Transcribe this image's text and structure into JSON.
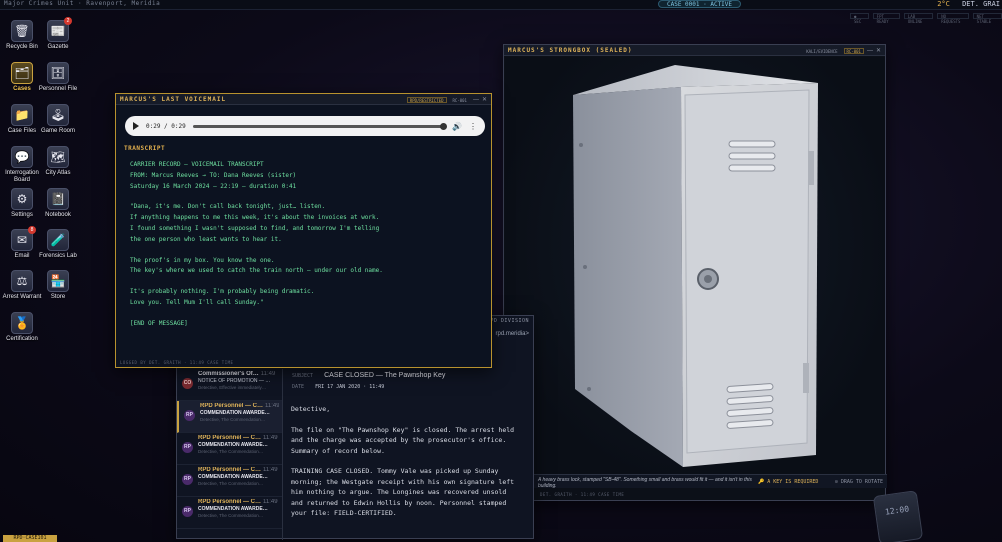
{
  "topbar": {
    "subtitle": "Major Crimes Unit · Ravenport, Meridia",
    "case_status": "CASE 0001 · ACTIVE",
    "temperature": "2°C",
    "detective": "DET. GRAI"
  },
  "status_strip": [
    "● SEC",
    "FPT READY",
    "LAB ONLINE",
    "NO REQUESTS",
    "NET STABLE"
  ],
  "desktop": {
    "icons": [
      {
        "label": "Recycle Bin",
        "glyph": "🗑",
        "icon": "trash-icon"
      },
      {
        "label": "Gazette",
        "glyph": "📰",
        "icon": "newspaper-icon",
        "badge": "2"
      },
      {
        "label": "Cases",
        "glyph": "🗂",
        "icon": "folder-icon",
        "active": true
      },
      {
        "label": "Personnel File",
        "glyph": "🗄",
        "icon": "cabinet-icon"
      },
      {
        "label": "Case Files",
        "glyph": "📁",
        "icon": "folder-icon"
      },
      {
        "label": "Game Room",
        "glyph": "🕹",
        "icon": "joystick-icon"
      },
      {
        "label": "Interrogation Board",
        "glyph": "💬",
        "icon": "speech-icon"
      },
      {
        "label": "City Atlas",
        "glyph": "🗺",
        "icon": "map-icon"
      },
      {
        "label": "Settings",
        "glyph": "⚙",
        "icon": "gear-icon"
      },
      {
        "label": "Notebook",
        "glyph": "📓",
        "icon": "notebook-icon"
      },
      {
        "label": "Email",
        "glyph": "✉",
        "icon": "mail-icon",
        "badge": "8"
      },
      {
        "label": "Forensics Lab",
        "glyph": "🧪",
        "icon": "flask-icon"
      },
      {
        "label": "Arrest Warrant",
        "glyph": "⚖",
        "icon": "scales-icon"
      },
      {
        "label": "Store",
        "glyph": "🏪",
        "icon": "store-icon"
      },
      {
        "label": "Certification",
        "glyph": "🏅",
        "icon": "medal-icon"
      }
    ]
  },
  "voicemail": {
    "title": "MARCUS'S LAST VOICEMAIL",
    "tag": "RPD/RESTRICTED",
    "tag2": "RC-001",
    "time": "0:29 / 0:29",
    "transcript_header": "TRANSCRIPT",
    "lines": [
      "CARRIER RECORD — VOICEMAIL TRANSCRIPT",
      "FROM: Marcus Reeves → TO: Dana Reeves (sister)",
      "Saturday 16 March 2024 — 22:19 — duration 0:41",
      "",
      "\"Dana, it's me. Don't call back tonight, just… listen.",
      "If anything happens to me this week, it's about the invoices at work.",
      "I found something I wasn't supposed to find, and tomorrow I'm telling",
      "the one person who least wants to hear it.",
      "",
      "The proof's in my box. You know the one.",
      "The key's where we used to catch the train north — under our old name.",
      "",
      "It's probably nothing. I'm probably being dramatic.",
      "Love you. Tell Mum I'll call Sunday.\"",
      "",
      "[END OF MESSAGE]"
    ],
    "footer": "LOGGED BY DET. GRAITH · 11:49 CASE TIME"
  },
  "strongbox": {
    "title": "MARCUS'S STRONGBOX (SEALED)",
    "tag": "KALI/EVIDENCE",
    "tag2": "RC-001",
    "description": "A heavy brass lock, stamped \"SB-48\". Something small and brass would fit it — and it isn't in this building.",
    "key_required": "🔑 A KEY IS REQUIRED",
    "zoom_hint": "⊙ DRAG TO ROTATE",
    "footer": "DET. GRAITH · 11:49 CASE TIME"
  },
  "email": {
    "division": "RPD DIVISION",
    "address": "rpd.meridia>",
    "subject_label": "SUBJECT",
    "subject": "CASE CLOSED — The Pawnshop Key",
    "date_label": "DATE",
    "date": "FRI 17 JAN 2020 · 11:49",
    "messages": [
      {
        "avatar": "CO",
        "from": "Commissioner's Of…",
        "time": "11:49",
        "subject": "NOTICE OF PROMOTION — …",
        "preview": "Detective, Effective immediately…",
        "kind": "notice"
      },
      {
        "avatar": "RP",
        "from": "RPD Personnel — C…",
        "time": "11:49",
        "subject": "COMMENDATION AWARDE…",
        "preview": "Detective, The Commendation…",
        "kind": "bold",
        "selected": true
      },
      {
        "avatar": "RP",
        "from": "RPD Personnel — C…",
        "time": "11:49",
        "subject": "COMMENDATION AWARDE…",
        "preview": "Detective, The Commendation…",
        "kind": "bold"
      },
      {
        "avatar": "RP",
        "from": "RPD Personnel — C…",
        "time": "11:49",
        "subject": "COMMENDATION AWARDE…",
        "preview": "Detective, The Commendation…",
        "kind": "bold"
      },
      {
        "avatar": "RP",
        "from": "RPD Personnel — C…",
        "time": "11:49",
        "subject": "COMMENDATION AWARDE…",
        "preview": "Detective, The Commendation…",
        "kind": "bold"
      }
    ],
    "body": [
      "Detective,",
      "",
      "The file on \"The Pawnshop Key\" is closed. The arrest held",
      "and the charge was accepted by the prosecutor's office.",
      "Summary of record below.",
      "",
      "TRAINING CASE CLOSED. Tommy Vale was picked up Sunday",
      "morning; the Westgate receipt with his own signature left",
      "him nothing to argue. The Longines was recovered unsold",
      "and returned to Edwin Hollis by noon. Personnel stamped",
      "your file: FIELD-CERTIFIED."
    ]
  },
  "bottom_tag": "RPD·CASE101",
  "phone_clock": "12:00",
  "colors": {
    "accent": "#e0b45a",
    "terminal": "#6ee0a0",
    "badge": "#d4382e"
  }
}
